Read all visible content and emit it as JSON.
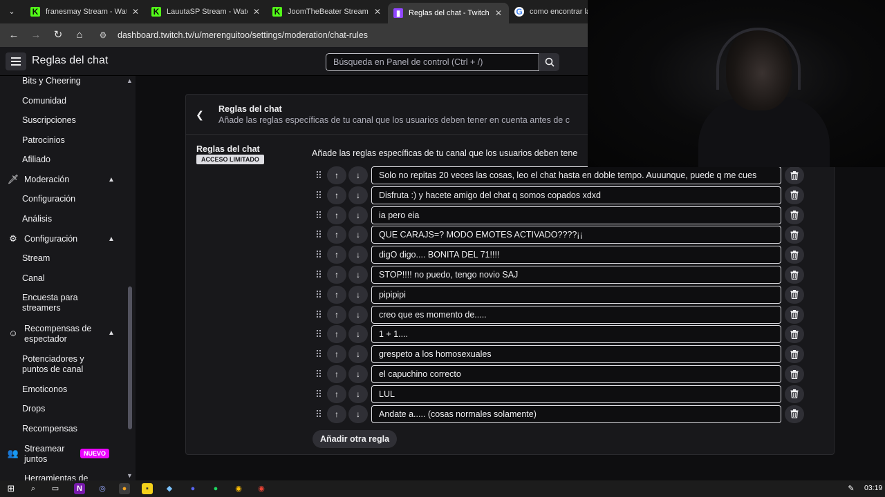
{
  "browser": {
    "tabs": [
      {
        "title": "franesmay Stream - Wat",
        "icon": "kick-icon",
        "active": false
      },
      {
        "title": "LauutaSP Stream - Watc",
        "icon": "kick-icon",
        "active": false
      },
      {
        "title": "JoomTheBeater Stream",
        "icon": "kick-icon",
        "active": false
      },
      {
        "title": "Reglas del chat - Twitch",
        "icon": "twitch-icon",
        "active": true
      },
      {
        "title": "como encontrar la",
        "icon": "google-icon",
        "active": false
      }
    ],
    "url": "dashboard.twitch.tv/u/merenguitoo/settings/moderation/chat-rules"
  },
  "header": {
    "title": "Reglas del chat",
    "search_placeholder": "Búsqueda en Panel de control (Ctrl + /)"
  },
  "sidebar": {
    "items": {
      "bits": "Bits y Cheering",
      "comunidad": "Comunidad",
      "suscripciones": "Suscripciones",
      "patrocinios": "Patrocinios",
      "afiliado": "Afiliado",
      "moderacion": "Moderación",
      "configuracion_mod": "Configuración",
      "analisis": "Análisis",
      "configuracion": "Configuración",
      "stream": "Stream",
      "canal": "Canal",
      "encuesta_1": "Encuesta para",
      "encuesta_2": "streamers",
      "recompensas_1": "Recompensas de",
      "recompensas_2": "espectador",
      "potenciadores_1": "Potenciadores y",
      "potenciadores_2": "puntos de canal",
      "emoticonos": "Emoticonos",
      "drops": "Drops",
      "recompensas": "Recompensas",
      "streamear_1": "Streamear",
      "streamear_2": "juntos",
      "nuevo": "NUEVO",
      "herramientas": "Herramientas de"
    }
  },
  "card": {
    "title": "Reglas del chat",
    "description": "Añade las reglas específicas de tu canal que los usuarios deben tener en cuenta antes de c",
    "section_label": "Reglas del chat",
    "access_badge": "ACCESO LIMITADO",
    "section_description": "Añade las reglas específicas de tu canal que los usuarios deben tene",
    "rules": [
      "Solo no repitas 20 veces las cosas, leo el chat hasta en doble tempo. Auuunque, puede q me cues",
      " Disfruta :) y hacete amigo del chat q somos copados xdxd",
      "ia pero eia",
      "QUE CARAJS=? MODO EMOTES ACTIVADO????¡¡",
      "digO digo.... BONITA DEL 71!!!!",
      "STOP!!!! no puedo, tengo novio SAJ",
      "pipipipi",
      "creo que es momento de.....",
      "1 + 1....",
      "grespeto a los homosexuales",
      "el capuchino correcto",
      "LUL",
      "Andate a..... (cosas normales solamente)"
    ],
    "add_rule_label": "Añadir otra regla"
  },
  "taskbar": {
    "clock": "03:19"
  },
  "colors": {
    "twitch_purple": "#9146ff",
    "kick_green": "#53fc18",
    "new_badge": "#eb04ff"
  }
}
